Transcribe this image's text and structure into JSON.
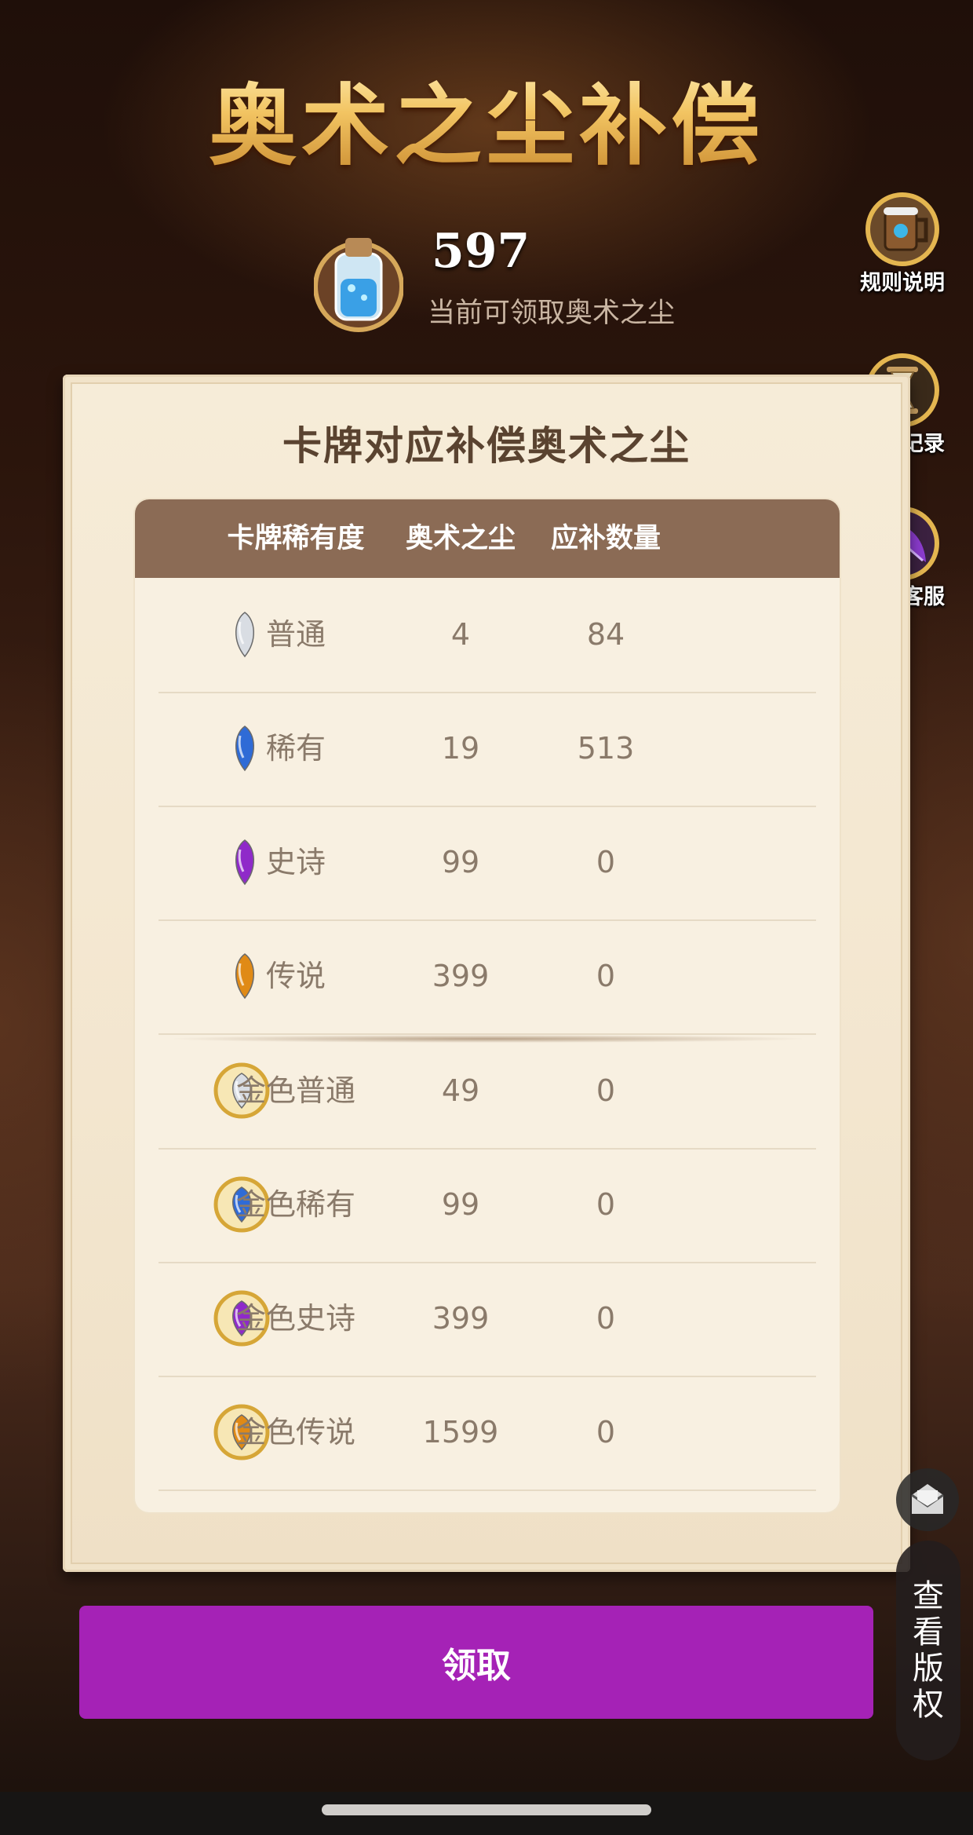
{
  "header": {
    "title": "奥术之尘补偿"
  },
  "dust": {
    "count": "597",
    "caption": "当前可领取奥术之尘"
  },
  "side_buttons": [
    {
      "label": "规则说明",
      "icon": "tankard-icon"
    },
    {
      "label": "发放记录",
      "icon": "hourglass-icon"
    },
    {
      "label": "联系客服",
      "icon": "quill-icon"
    }
  ],
  "card": {
    "title": "卡牌对应补偿奥术之尘",
    "columns": [
      "卡牌稀有度",
      "奥术之尘",
      "应补数量"
    ],
    "rows": [
      {
        "rarity": "普通",
        "dust": "4",
        "qty": "84",
        "gem_color": "#d9dde3",
        "golden": false
      },
      {
        "rarity": "稀有",
        "dust": "19",
        "qty": "513",
        "gem_color": "#2f6bd6",
        "golden": false
      },
      {
        "rarity": "史诗",
        "dust": "99",
        "qty": "0",
        "gem_color": "#8f2ac9",
        "golden": false
      },
      {
        "rarity": "传说",
        "dust": "399",
        "qty": "0",
        "gem_color": "#e08a16",
        "golden": false
      },
      {
        "rarity": "金色普通",
        "dust": "49",
        "qty": "0",
        "gem_color": "#d9dde3",
        "golden": true
      },
      {
        "rarity": "金色稀有",
        "dust": "99",
        "qty": "0",
        "gem_color": "#2f6bd6",
        "golden": true
      },
      {
        "rarity": "金色史诗",
        "dust": "399",
        "qty": "0",
        "gem_color": "#8f2ac9",
        "golden": true
      },
      {
        "rarity": "金色传说",
        "dust": "1599",
        "qty": "0",
        "gem_color": "#e08a16",
        "golden": true
      }
    ]
  },
  "claim_button": {
    "label": "领取",
    "color": "#a522b6"
  },
  "floating": {
    "copyright_label": "查看版权",
    "mail_icon": "mail-icon"
  }
}
